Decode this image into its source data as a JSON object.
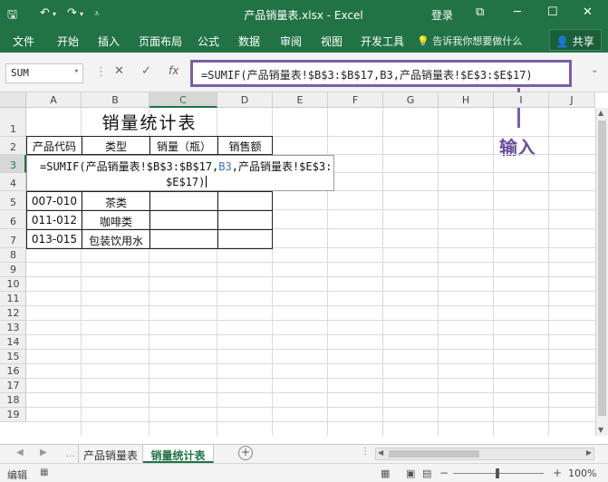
{
  "titlebar": {
    "title": "产品销量表.xlsx - Excel",
    "login": "登录",
    "save_icon": "save-icon",
    "undo_icon": "undo-icon",
    "redo_icon": "redo-icon"
  },
  "ribbon": {
    "tabs": [
      "文件",
      "开始",
      "插入",
      "页面布局",
      "公式",
      "数据",
      "审阅",
      "视图",
      "开发工具"
    ],
    "tell_me": "告诉我你想要做什么",
    "share": "共享"
  },
  "formula_bar": {
    "name_box": "SUM",
    "formula": "=SUMIF(产品销量表!$B$3:$B$17,B3,产品销量表!$E$3:$E$17)"
  },
  "columns": [
    "A",
    "B",
    "C",
    "D",
    "E",
    "F",
    "G",
    "H",
    "I",
    "J"
  ],
  "selected_column": "C",
  "rows": [
    "1",
    "2",
    "3",
    "4",
    "5",
    "6",
    "7",
    "8",
    "9",
    "10",
    "11",
    "12",
    "13",
    "14",
    "15",
    "16",
    "17",
    "18",
    "19"
  ],
  "selected_row": "3",
  "sheet": {
    "title": "销量统计表",
    "headers": [
      "产品代码",
      "类型",
      "销量（瓶）",
      "销售额"
    ],
    "edit_line1_pre": "=SUMIF(产品销量表!$B$3:$B$17,",
    "edit_line1_ref": "B3",
    "edit_line1_post": ",产品销量表!$E$3:",
    "edit_line2": "$E$17)",
    "data_rows": [
      [
        "007-010",
        "茶类",
        "",
        ""
      ],
      [
        "011-012",
        "咖啡类",
        "",
        ""
      ],
      [
        "013-015",
        "包装饮用水",
        "",
        ""
      ]
    ]
  },
  "annotation": {
    "label": "输入",
    "color": "#7b5ea7"
  },
  "sheet_tabs": [
    "产品销量表",
    "销量统计表"
  ],
  "active_sheet": "销量统计表",
  "status": {
    "mode": "编辑",
    "zoom": "100%"
  },
  "colors": {
    "excel_green": "#217346",
    "annotation_purple": "#7b5ea7"
  }
}
